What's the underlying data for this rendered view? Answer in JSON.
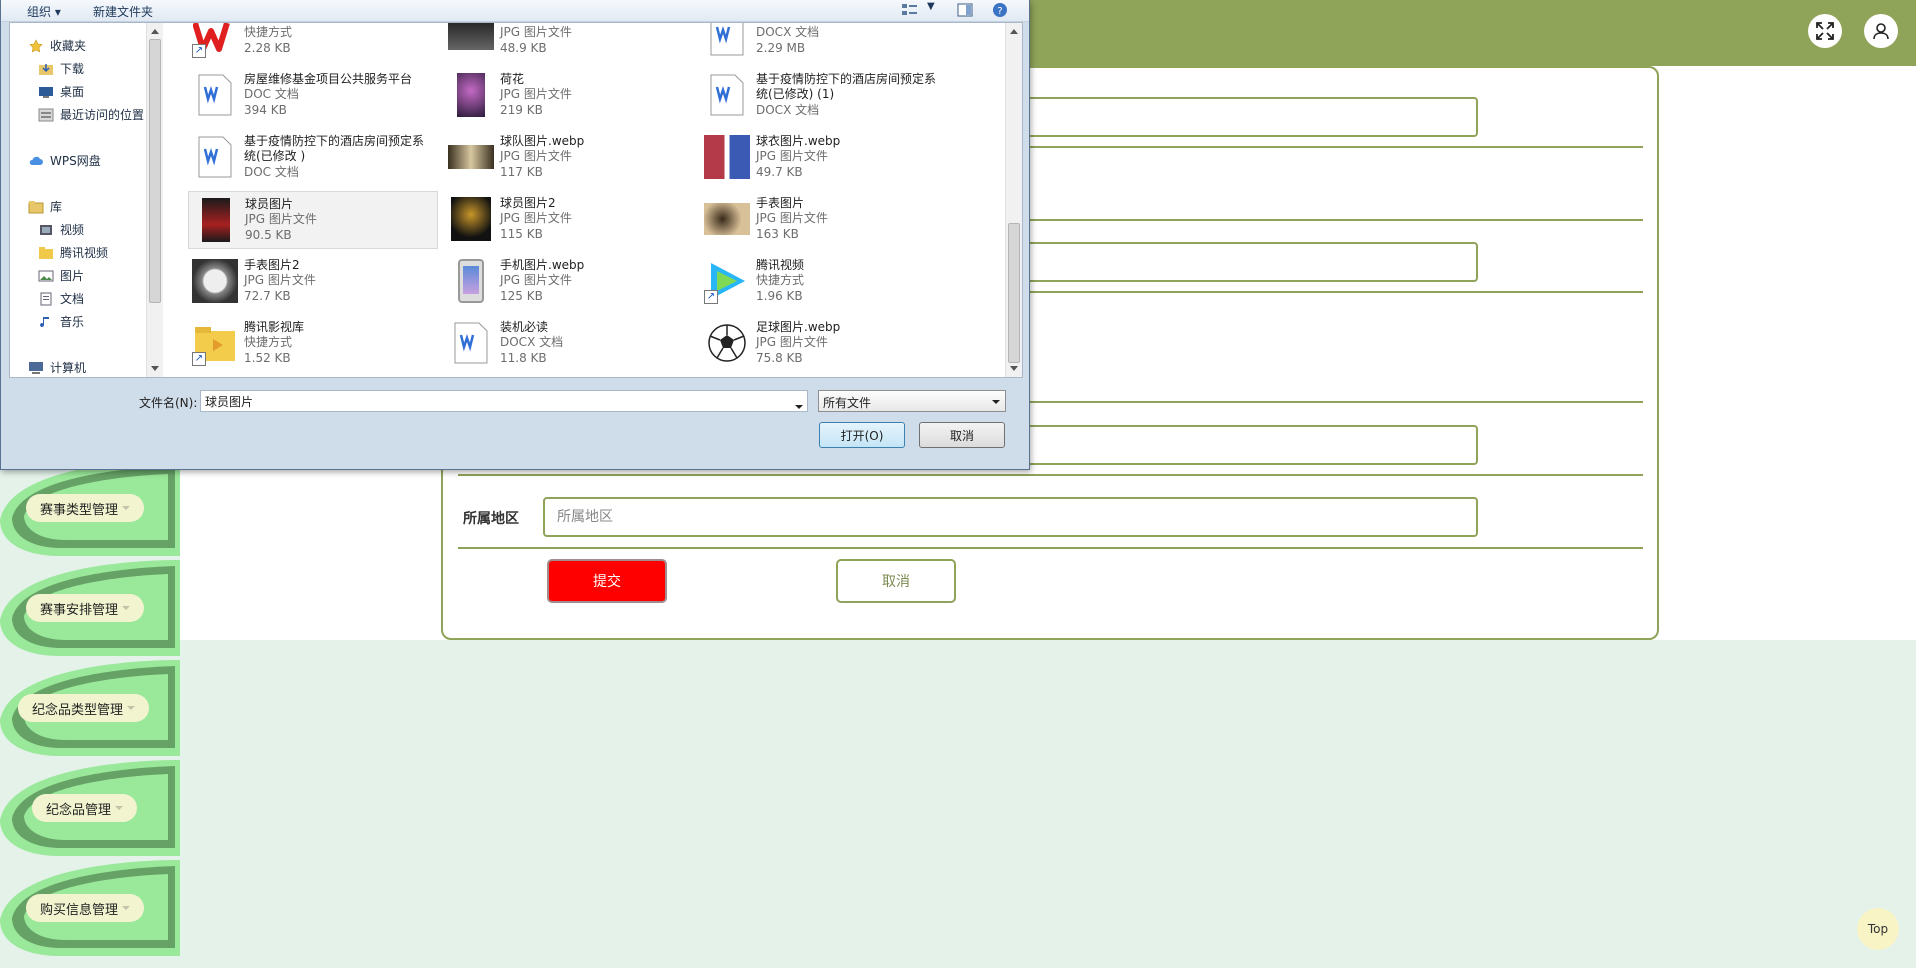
{
  "page": {
    "colors": {
      "accent": "#8fa359",
      "submit": "#ff0000",
      "background": "#e4f2ea"
    },
    "header": {
      "fullscreen_icon": "expand-icon",
      "user_icon": "user-icon"
    },
    "form": {
      "fields": [
        {
          "label": "所属地区",
          "placeholder": "所属地区"
        }
      ],
      "submit_label": "提交",
      "cancel_label": "取消"
    },
    "sidebar": {
      "items": [
        {
          "label": "赛事类型管理"
        },
        {
          "label": "赛事安排管理"
        },
        {
          "label": "纪念品类型管理"
        },
        {
          "label": "纪念品管理"
        },
        {
          "label": "购买信息管理"
        }
      ]
    },
    "top_button": "Top"
  },
  "dialog": {
    "toolbar": {
      "organize": "组织",
      "new_folder": "新建文件夹"
    },
    "nav": [
      {
        "label": "收藏夹",
        "icon": "star-icon"
      },
      {
        "label": "下载",
        "icon": "download-folder-icon"
      },
      {
        "label": "桌面",
        "icon": "desktop-icon"
      },
      {
        "label": "最近访问的位置",
        "icon": "recent-places-icon"
      },
      {
        "label": "WPS网盘",
        "icon": "cloud-icon"
      },
      {
        "label": "库",
        "icon": "library-icon"
      },
      {
        "label": "视频",
        "icon": "video-library-icon"
      },
      {
        "label": "腾讯视频",
        "icon": "folder-icon"
      },
      {
        "label": "图片",
        "icon": "picture-library-icon"
      },
      {
        "label": "文档",
        "icon": "document-library-icon"
      },
      {
        "label": "音乐",
        "icon": "music-library-icon"
      },
      {
        "label": "计算机",
        "icon": "computer-icon"
      }
    ],
    "files": [
      {
        "name": "",
        "type": "快捷方式",
        "size": "2.28 KB",
        "thumb": "wps-shortcut-icon"
      },
      {
        "name": "",
        "type": "JPG 图片文件",
        "size": "48.9 KB",
        "thumb": "image-thumbnail"
      },
      {
        "name": "",
        "type": "DOCX 文档",
        "size": "2.29 MB",
        "thumb": "word-document-icon"
      },
      {
        "name": "房屋维修基金项目公共服务平台",
        "type": "DOC 文档",
        "size": "394 KB",
        "thumb": "word-document-icon"
      },
      {
        "name": "荷花",
        "type": "JPG 图片文件",
        "size": "219 KB",
        "thumb": "image-thumbnail"
      },
      {
        "name": "基于疫情防控下的酒店房间预定系统(已修改) (1)",
        "type": "DOCX 文档",
        "size": "",
        "thumb": "word-document-icon"
      },
      {
        "name": "基于疫情防控下的酒店房间预定系统(已修改 )",
        "type": "DOC 文档",
        "size": "",
        "thumb": "word-document-icon"
      },
      {
        "name": "球队图片.webp",
        "type": "JPG 图片文件",
        "size": "117 KB",
        "thumb": "image-thumbnail"
      },
      {
        "name": "球衣图片.webp",
        "type": "JPG 图片文件",
        "size": "49.7 KB",
        "thumb": "image-thumbnail"
      },
      {
        "name": "球员图片",
        "type": "JPG 图片文件",
        "size": "90.5 KB",
        "thumb": "image-thumbnail"
      },
      {
        "name": "球员图片2",
        "type": "JPG 图片文件",
        "size": "115 KB",
        "thumb": "image-thumbnail"
      },
      {
        "name": "手表图片",
        "type": "JPG 图片文件",
        "size": "163 KB",
        "thumb": "image-thumbnail"
      },
      {
        "name": "手表图片2",
        "type": "JPG 图片文件",
        "size": "72.7 KB",
        "thumb": "image-thumbnail"
      },
      {
        "name": "手机图片.webp",
        "type": "JPG 图片文件",
        "size": "125 KB",
        "thumb": "image-thumbnail"
      },
      {
        "name": "腾讯视频",
        "type": "快捷方式",
        "size": "1.96 KB",
        "thumb": "tencent-video-shortcut-icon"
      },
      {
        "name": "腾讯影视库",
        "type": "快捷方式",
        "size": "1.52 KB",
        "thumb": "folder-shortcut-icon"
      },
      {
        "name": "装机必读",
        "type": "DOCX 文档",
        "size": "11.8 KB",
        "thumb": "word-document-icon"
      },
      {
        "name": "足球图片.webp",
        "type": "JPG 图片文件",
        "size": "75.8 KB",
        "thumb": "soccer-ball-thumbnail"
      }
    ],
    "filename_label": "文件名(N):",
    "filename_value": "球员图片",
    "file_type": "所有文件",
    "open_label": "打开(O)",
    "cancel_label": "取消"
  }
}
